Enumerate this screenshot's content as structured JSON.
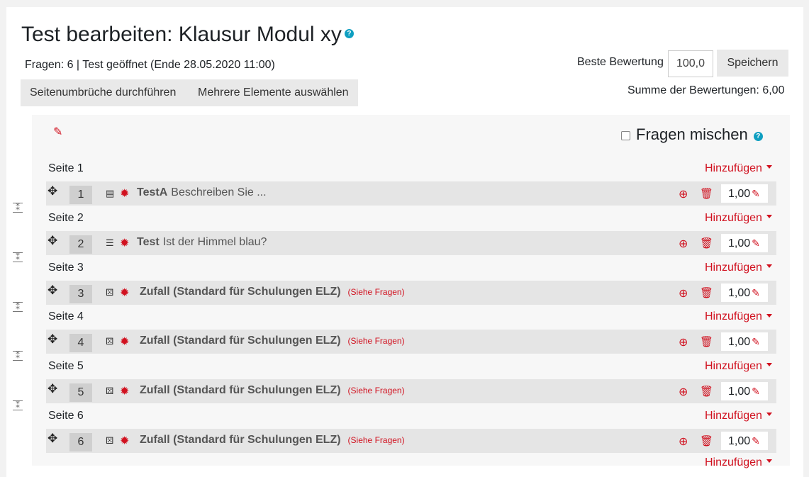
{
  "header": {
    "title": "Test bearbeiten: Klausur Modul xy",
    "help_icon": "?",
    "status": "Fragen: 6 | Test geöffnet (Ende 28.05.2020 11:00)"
  },
  "toolbar": {
    "repaginate_label": "Seitenumbrüche durchführen",
    "select_multiple_label": "Mehrere Elemente auswählen"
  },
  "grading": {
    "max_grade_label": "Beste Bewertung",
    "max_grade_value": "100,0",
    "save_label": "Speichern",
    "sum_label": "Summe der Bewertungen: 6,00"
  },
  "section": {
    "shuffle_label": "Fragen mischen",
    "shuffle_checked": false,
    "add_label": "Hinzufügen",
    "pages": [
      {
        "label": "Seite 1",
        "question": {
          "number": "1",
          "type_icon": "essay-icon",
          "name": "TestA",
          "text": "Beschreiben Sie ...",
          "see": "",
          "mark": "1,00"
        }
      },
      {
        "label": "Seite 2",
        "question": {
          "number": "2",
          "type_icon": "multichoice-icon",
          "name": "Test",
          "text": "Ist der Himmel blau?",
          "see": "",
          "mark": "1,00"
        }
      },
      {
        "label": "Seite 3",
        "question": {
          "number": "3",
          "type_icon": "random-icon",
          "name": "Zufall (Standard für Schulungen ELZ)",
          "text": "",
          "see": "(Siehe Fragen)",
          "mark": "1,00"
        }
      },
      {
        "label": "Seite 4",
        "question": {
          "number": "4",
          "type_icon": "random-icon",
          "name": "Zufall (Standard für Schulungen ELZ)",
          "text": "",
          "see": "(Siehe Fragen)",
          "mark": "1,00"
        }
      },
      {
        "label": "Seite 5",
        "question": {
          "number": "5",
          "type_icon": "random-icon",
          "name": "Zufall (Standard für Schulungen ELZ)",
          "text": "",
          "see": "(Siehe Fragen)",
          "mark": "1,00"
        }
      },
      {
        "label": "Seite 6",
        "question": {
          "number": "6",
          "type_icon": "random-icon",
          "name": "Zufall (Standard für Schulungen ELZ)",
          "text": "",
          "see": "(Siehe Fragen)",
          "mark": "1,00"
        }
      }
    ]
  },
  "colors": {
    "accent": "#d1111f",
    "help": "#0f9fc1"
  }
}
